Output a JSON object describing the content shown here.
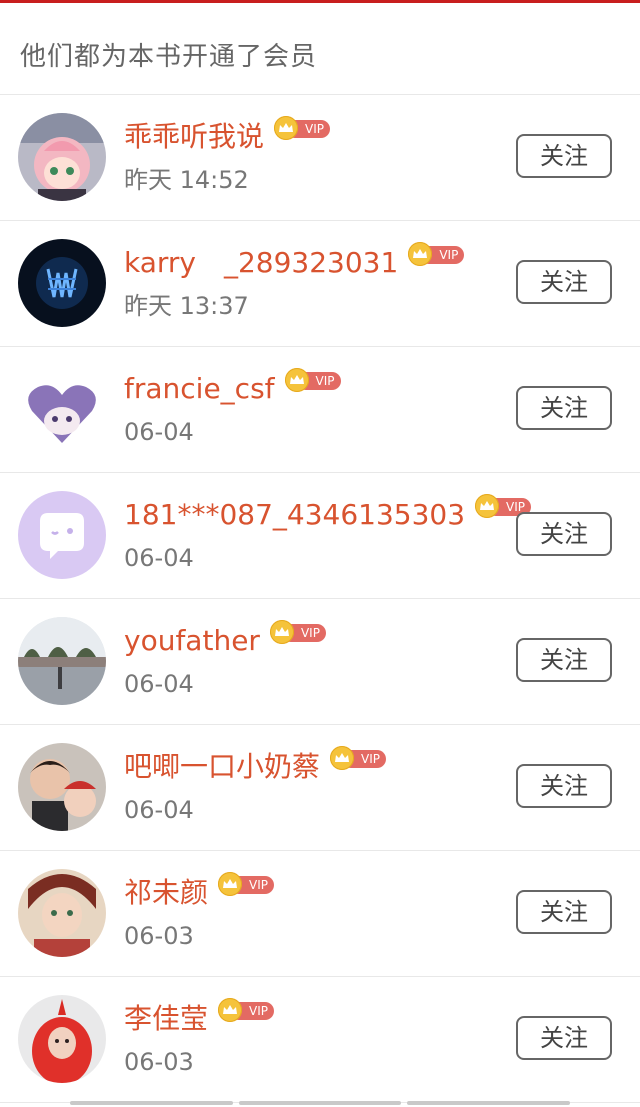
{
  "header": {
    "title": "他们都为本书开通了会员"
  },
  "colors": {
    "accent": "#d8532f",
    "vip": "#e36a63",
    "crown": "#f5c33b"
  },
  "vip_label": "VIP",
  "members": [
    {
      "name": "乖乖听我说",
      "time": "昨天 14:52",
      "follow_label": "关注",
      "avatar": "anime-pink-hair-avatar"
    },
    {
      "name": "karry　_289323031",
      "time": "昨天 13:37",
      "follow_label": "关注",
      "avatar": "blue-glow-logo-avatar"
    },
    {
      "name": "francie_csf",
      "time": "06-04",
      "follow_label": "关注",
      "avatar": "purple-heart-boy-avatar"
    },
    {
      "name": "181***087_4346135303",
      "time": "06-04",
      "follow_label": "关注",
      "avatar": "default-chat-avatar"
    },
    {
      "name": "youfather",
      "time": "06-04",
      "follow_label": "关注",
      "avatar": "park-photo-avatar"
    },
    {
      "name": "吧唧一口小奶蔡",
      "time": "06-04",
      "follow_label": "关注",
      "avatar": "couple-photo-avatar"
    },
    {
      "name": "祁未颜",
      "time": "06-03",
      "follow_label": "关注",
      "avatar": "illustrated-character-avatar"
    },
    {
      "name": "李佳莹",
      "time": "06-03",
      "follow_label": "关注",
      "avatar": "red-costume-avatar"
    }
  ]
}
